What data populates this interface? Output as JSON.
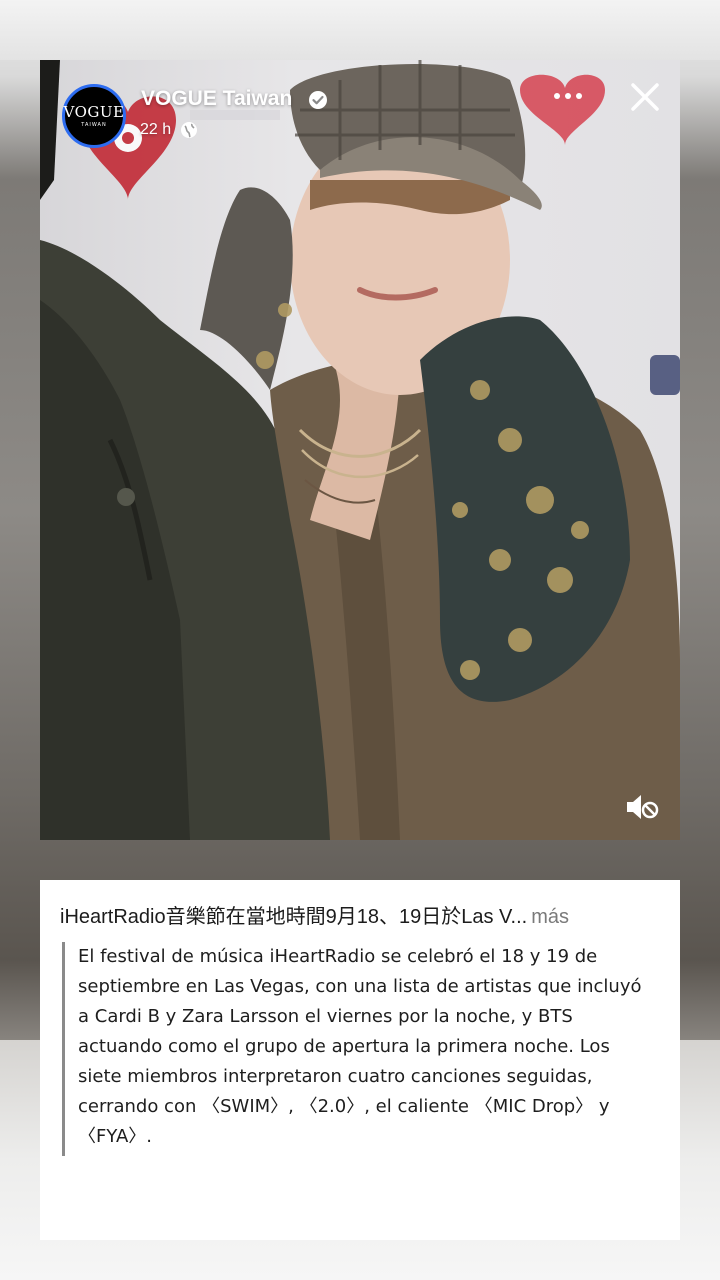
{
  "account": {
    "name": "VOGUE Taiwan",
    "avatar_logo": "VOGUE",
    "avatar_subtext": "TAIWAN",
    "time": "22 h",
    "verified_icon": "verified-badge-icon",
    "privacy_icon": "globe-icon"
  },
  "controls": {
    "more_icon": "more-options-icon",
    "close_icon": "close-icon",
    "mute_icon": "speaker-muted-icon"
  },
  "caption": {
    "summary": "iHeartRadio音樂節在當地時間9月18、19日於Las V...",
    "more_label": "más",
    "body": "El festival de música iHeartRadio se celebró el 18 y 19 de septiembre en Las Vegas, con una lista de artistas que incluyó a Cardi B y Zara Larsson el viernes por la noche, y BTS actuando como el grupo de apertura la primera noche. Los siete miembros interpretaron cuatro canciones seguidas, cerrando con 〈SWIM〉, 〈2.0〉, el caliente 〈MIC Drop〉 y 〈FYA〉."
  },
  "colors": {
    "avatar_ring": "#2d6cf0",
    "backdrop_text": "#c0202c"
  }
}
